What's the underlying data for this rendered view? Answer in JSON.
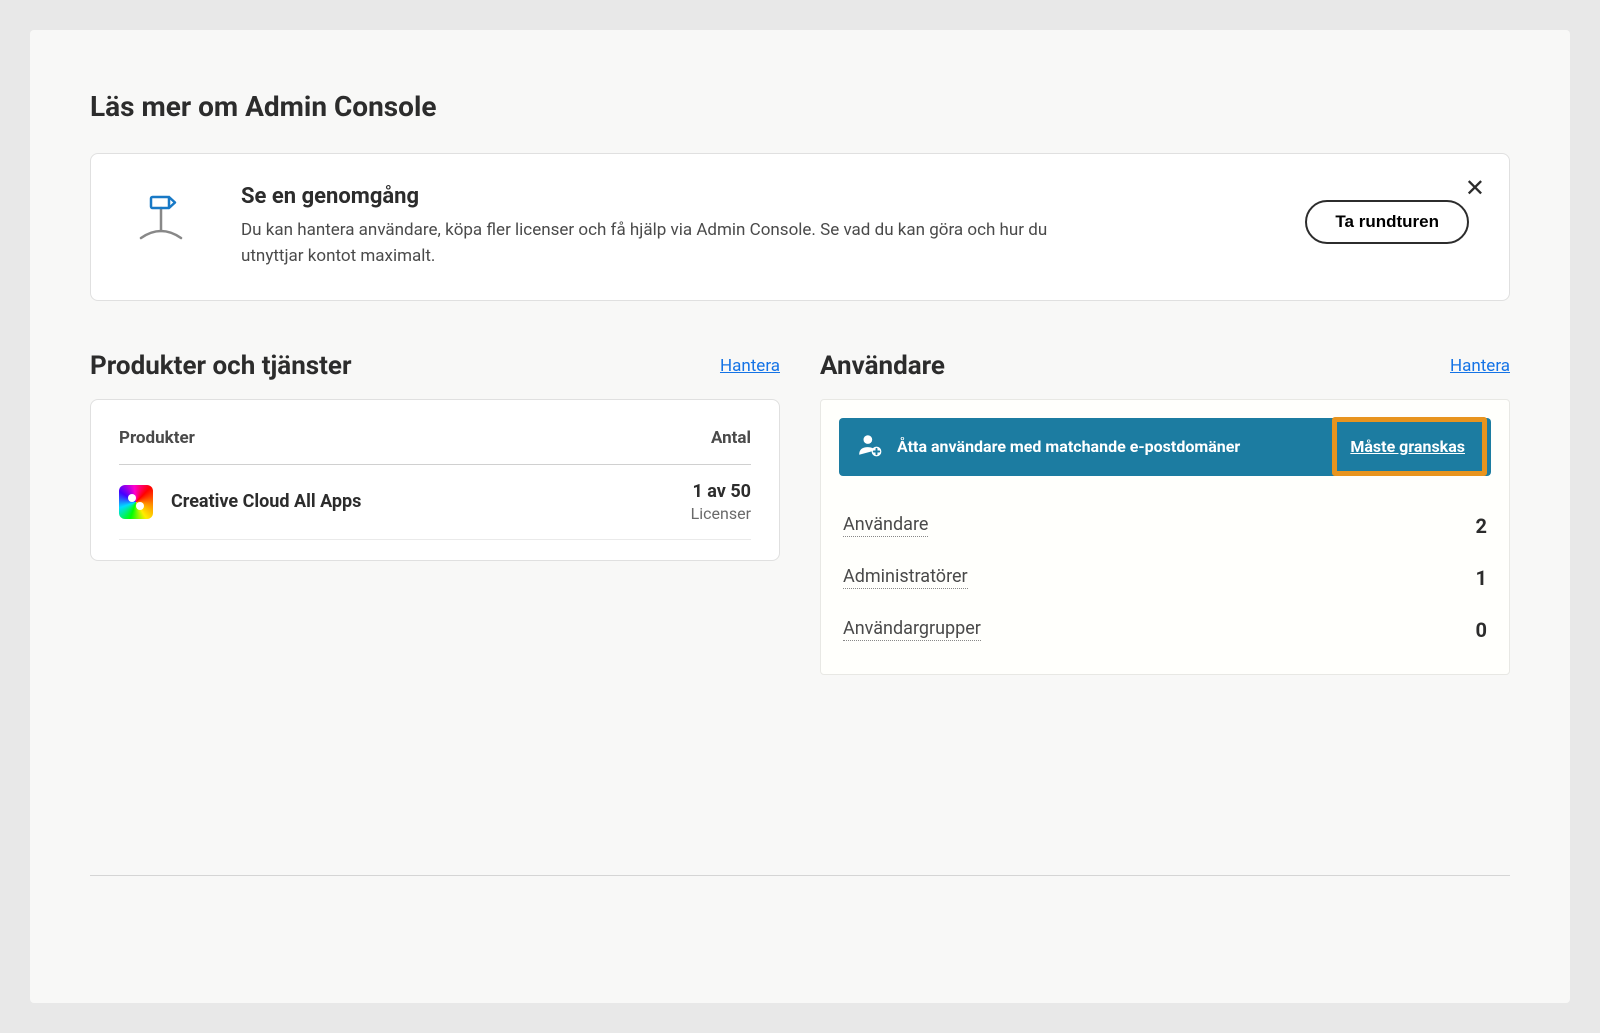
{
  "page_title": "Läs mer om Admin Console",
  "walkthrough": {
    "title": "Se en genomgång",
    "description": "Du kan hantera användare, köpa fler licenser och få hjälp via Admin Console. Se vad du kan göra och hur du utnyttjar kontot maximalt.",
    "button_label": "Ta rundturen"
  },
  "products_section": {
    "title": "Produkter och tjänster",
    "manage_link": "Hantera",
    "header_products": "Produkter",
    "header_count": "Antal",
    "items": [
      {
        "name": "Creative Cloud All Apps",
        "count": "1 av 50",
        "licenses_label": "Licenser"
      }
    ]
  },
  "users_section": {
    "title": "Användare",
    "manage_link": "Hantera",
    "alert_text": "Åtta användare med matchande e-postdomäner",
    "alert_link": "Måste granskas",
    "rows": [
      {
        "label": "Användare",
        "value": "2"
      },
      {
        "label": "Administratörer",
        "value": "1"
      },
      {
        "label": "Användargrupper",
        "value": "0"
      }
    ]
  }
}
